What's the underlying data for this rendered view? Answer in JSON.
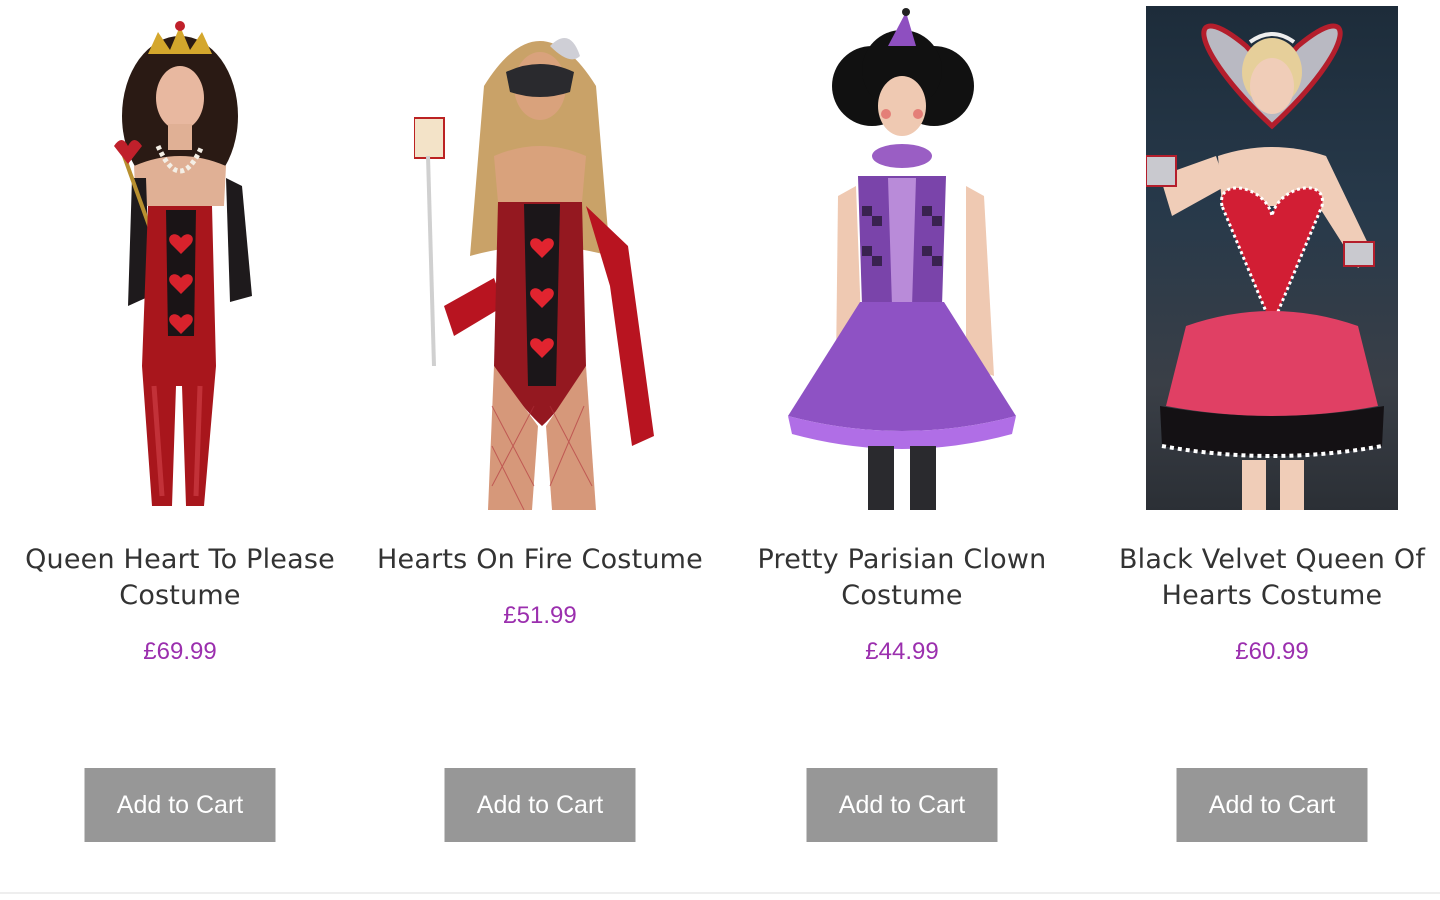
{
  "products": [
    {
      "name": "Queen Heart To Please Costume",
      "price": "£69.99",
      "button": "Add to Cart"
    },
    {
      "name": "Hearts On Fire Costume",
      "price": "£51.99",
      "button": "Add to Cart"
    },
    {
      "name": "Pretty Parisian Clown Costume",
      "price": "£44.99",
      "button": "Add to Cart"
    },
    {
      "name": "Black Velvet Queen Of Hearts Costume",
      "price": "£60.99",
      "button": "Add to Cart"
    }
  ],
  "colors": {
    "price": "#9b2fae",
    "button_bg": "#979797",
    "button_text": "#ffffff",
    "title_text": "#333333"
  }
}
